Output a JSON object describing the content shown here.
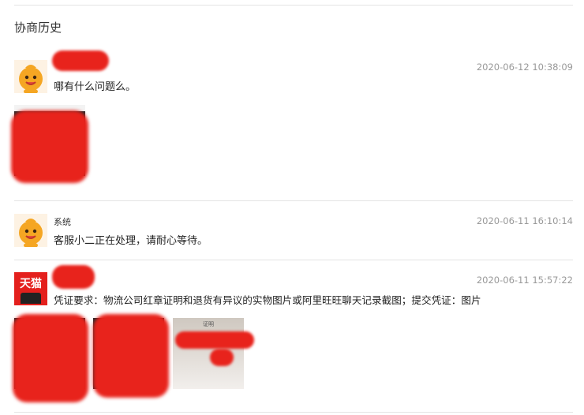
{
  "header": {
    "title": "协商历史"
  },
  "entries": [
    {
      "sender": "",
      "time": "2020-06-12 10:38:09",
      "text": "哪有什么问题么。",
      "avatar": "orange-mascot-avatar"
    },
    {
      "sender": "系统",
      "time": "2020-06-11 16:10:14",
      "text": "客服小二正在处理，请耐心等待。",
      "avatar": "orange-mascot-avatar"
    },
    {
      "sender": "",
      "time": "2020-06-11 15:57:22",
      "text": "凭证要求：物流公司红章证明和退货有异议的实物图片或阿里旺旺聊天记录截图；提交凭证：图片",
      "avatar": "tmall-avatar",
      "avatar_label": "天猫"
    }
  ],
  "attachments": {
    "light_image_caption": "证明"
  },
  "colors": {
    "redaction": "#e8231c",
    "tmall_red": "#e4201d",
    "mascot_orange": "#f5a623"
  }
}
